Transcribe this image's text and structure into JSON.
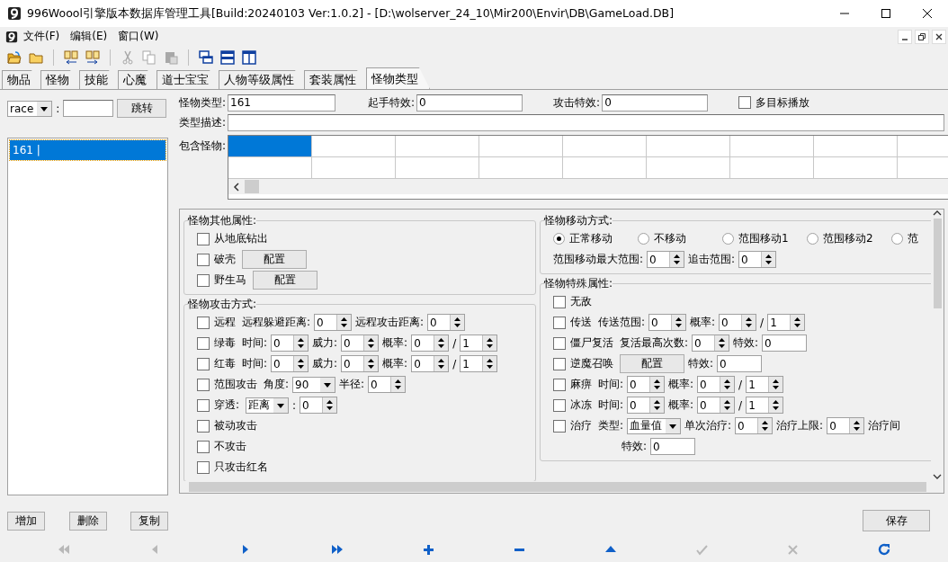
{
  "window": {
    "title": "996Woool引擎版本数据库管理工具[Build:20240103 Ver:1.0.2] - [D:\\wolserver_24_10\\Mir200\\Envir\\DB\\GameLoad.DB]"
  },
  "menu": [
    {
      "label": "文件(F)"
    },
    {
      "label": "编辑(E)"
    },
    {
      "label": "窗口(W)"
    }
  ],
  "toolbar": [
    [
      {
        "kind": "open-folder",
        "disabled": false
      },
      {
        "kind": "folder",
        "disabled": false
      }
    ],
    [
      {
        "kind": "copy-left",
        "disabled": false
      },
      {
        "kind": "copy-right",
        "disabled": false
      }
    ],
    [
      {
        "kind": "cut",
        "disabled": true
      },
      {
        "kind": "copy",
        "disabled": true
      },
      {
        "kind": "paste",
        "disabled": true
      }
    ],
    [
      {
        "kind": "cascade",
        "disabled": false
      },
      {
        "kind": "tile-horizontal",
        "disabled": false
      },
      {
        "kind": "tile-vertical",
        "disabled": false
      }
    ]
  ],
  "tabs": [
    {
      "label": "物品",
      "selected": false
    },
    {
      "label": "怪物",
      "selected": false
    },
    {
      "label": "技能",
      "selected": false
    },
    {
      "label": "心魔",
      "selected": false
    },
    {
      "label": "道士宝宝",
      "selected": false
    },
    {
      "label": "人物等级属性",
      "selected": false
    },
    {
      "label": "套装属性",
      "selected": false
    },
    {
      "label": "怪物类型",
      "selected": true
    }
  ],
  "search": {
    "field": "race",
    "separator": ":",
    "button": "跳转"
  },
  "records": [
    {
      "label": "161 |",
      "selected": true
    }
  ],
  "list_buttons": [
    "增加",
    "删除",
    "复制"
  ],
  "header": {
    "type_label": "怪物类型:",
    "type_value": "161",
    "start_label": "起手特效:",
    "start_value": "0",
    "attack_label": "攻击特效:",
    "attack_value": "0",
    "multi_target": {
      "label": "多目标播放",
      "checked": false
    },
    "desc_label": "类型描述:",
    "monsters_label": "包含怪物:"
  },
  "monster_grid": [
    [
      {
        "selected": true
      },
      {
        "selected": false
      },
      {
        "selected": false
      },
      {
        "selected": false
      },
      {
        "selected": false
      },
      {
        "selected": false
      },
      {
        "selected": false
      },
      {
        "selected": false
      },
      {
        "selected": false
      }
    ],
    [
      {
        "selected": false
      },
      {
        "selected": false
      },
      {
        "selected": false
      },
      {
        "selected": false
      },
      {
        "selected": false
      },
      {
        "selected": false
      },
      {
        "selected": false
      },
      {
        "selected": false
      },
      {
        "selected": false
      }
    ]
  ],
  "left_groups": [
    {
      "title": "怪物其他属性:",
      "rows": [
        {
          "items": [
            {
              "kind": "checkbox",
              "label": "从地底钻出",
              "checked": false
            }
          ]
        },
        {
          "items": [
            {
              "kind": "checkbox",
              "label": "破壳",
              "checked": false
            },
            {
              "kind": "button",
              "label": "配置"
            }
          ]
        },
        {
          "items": [
            {
              "kind": "checkbox",
              "label": "野生马",
              "checked": false
            },
            {
              "kind": "button",
              "label": "配置"
            }
          ]
        }
      ]
    },
    {
      "title": "怪物攻击方式:",
      "rows": [
        {
          "items": [
            {
              "kind": "checkbox",
              "label": "远程",
              "checked": false
            },
            {
              "kind": "label",
              "text": "远程躲避距离:"
            },
            {
              "kind": "spin",
              "value": "0"
            },
            {
              "kind": "label",
              "text": "远程攻击距离:"
            },
            {
              "kind": "spin",
              "value": "0"
            }
          ]
        },
        {
          "items": [
            {
              "kind": "checkbox",
              "label": "绿毒",
              "checked": false
            },
            {
              "kind": "label",
              "text": "时间:"
            },
            {
              "kind": "spin",
              "value": "0"
            },
            {
              "kind": "label",
              "text": "威力:"
            },
            {
              "kind": "spin",
              "value": "0"
            },
            {
              "kind": "label",
              "text": "概率:"
            },
            {
              "kind": "spin",
              "value": "0"
            },
            {
              "kind": "label",
              "text": "/"
            },
            {
              "kind": "spin",
              "value": "1"
            }
          ]
        },
        {
          "items": [
            {
              "kind": "checkbox",
              "label": "红毒",
              "checked": false
            },
            {
              "kind": "label",
              "text": "时间:"
            },
            {
              "kind": "spin",
              "value": "0"
            },
            {
              "kind": "label",
              "text": "威力:"
            },
            {
              "kind": "spin",
              "value": "0"
            },
            {
              "kind": "label",
              "text": "概率:"
            },
            {
              "kind": "spin",
              "value": "0"
            },
            {
              "kind": "label",
              "text": "/"
            },
            {
              "kind": "spin",
              "value": "1"
            }
          ]
        },
        {
          "items": [
            {
              "kind": "checkbox",
              "label": "范围攻击",
              "checked": false
            },
            {
              "kind": "label",
              "text": "角度:"
            },
            {
              "kind": "combo",
              "value": "90"
            },
            {
              "kind": "label",
              "text": "半径:"
            },
            {
              "kind": "spin",
              "value": "0"
            }
          ]
        },
        {
          "items": [
            {
              "kind": "checkbox",
              "label": "穿透:",
              "checked": false
            },
            {
              "kind": "combo",
              "value": "距离"
            },
            {
              "kind": "label",
              "text": ":"
            },
            {
              "kind": "spin",
              "value": "0"
            }
          ]
        },
        {
          "items": [
            {
              "kind": "checkbox",
              "label": "被动攻击",
              "checked": false
            }
          ]
        },
        {
          "items": [
            {
              "kind": "checkbox",
              "label": "不攻击",
              "checked": false
            }
          ]
        },
        {
          "items": [
            {
              "kind": "checkbox",
              "label": "只攻击红名",
              "checked": false
            }
          ]
        }
      ]
    }
  ],
  "right_groups": [
    {
      "title": "怪物移动方式:",
      "rows": [
        {
          "items": [
            {
              "kind": "radio",
              "label": "正常移动",
              "selected": true
            },
            {
              "kind": "radio",
              "label": "不移动",
              "selected": false
            },
            {
              "kind": "radio",
              "label": "范围移动1",
              "selected": false
            },
            {
              "kind": "radio",
              "label": "范围移动2",
              "selected": false
            },
            {
              "kind": "radio",
              "label": "范",
              "selected": false
            }
          ]
        },
        {
          "items": [
            {
              "kind": "label",
              "text": "范围移动最大范围:"
            },
            {
              "kind": "spin",
              "value": "0"
            },
            {
              "kind": "label",
              "text": "追击范围:"
            },
            {
              "kind": "spin",
              "value": "0"
            }
          ]
        }
      ]
    },
    {
      "title": "怪物特殊属性:",
      "rows": [
        {
          "items": [
            {
              "kind": "checkbox",
              "label": "无敌",
              "checked": false
            }
          ]
        },
        {
          "items": [
            {
              "kind": "checkbox",
              "label": "传送",
              "checked": false
            },
            {
              "kind": "label",
              "text": "传送范围:"
            },
            {
              "kind": "spin",
              "value": "0"
            },
            {
              "kind": "label",
              "text": "概率:"
            },
            {
              "kind": "spin",
              "value": "0"
            },
            {
              "kind": "label",
              "text": "/"
            },
            {
              "kind": "spin",
              "value": "1"
            }
          ]
        },
        {
          "items": [
            {
              "kind": "checkbox",
              "label": "僵尸复活",
              "checked": false
            },
            {
              "kind": "label",
              "text": "复活最高次数:"
            },
            {
              "kind": "spin",
              "value": "0"
            },
            {
              "kind": "label",
              "text": "特效:"
            },
            {
              "kind": "text",
              "value": "0"
            }
          ]
        },
        {
          "items": [
            {
              "kind": "checkbox",
              "label": "逆魔召唤",
              "checked": false
            },
            {
              "kind": "button",
              "label": "配置"
            },
            {
              "kind": "label",
              "text": "特效:"
            },
            {
              "kind": "text",
              "value": "0"
            }
          ]
        },
        {
          "items": [
            {
              "kind": "checkbox",
              "label": "麻痹",
              "checked": false
            },
            {
              "kind": "label",
              "text": "时间:"
            },
            {
              "kind": "spin",
              "value": "0"
            },
            {
              "kind": "label",
              "text": "概率:"
            },
            {
              "kind": "spin",
              "value": "0"
            },
            {
              "kind": "label",
              "text": "/"
            },
            {
              "kind": "spin",
              "value": "1"
            }
          ]
        },
        {
          "items": [
            {
              "kind": "checkbox",
              "label": "冰冻",
              "checked": false
            },
            {
              "kind": "label",
              "text": "时间:"
            },
            {
              "kind": "spin",
              "value": "0"
            },
            {
              "kind": "label",
              "text": "概率:"
            },
            {
              "kind": "spin",
              "value": "0"
            },
            {
              "kind": "label",
              "text": "/"
            },
            {
              "kind": "spin",
              "value": "1"
            }
          ]
        },
        {
          "items": [
            {
              "kind": "checkbox",
              "label": "治疗",
              "checked": false
            },
            {
              "kind": "label",
              "text": "类型:"
            },
            {
              "kind": "combo",
              "value": "血量值"
            },
            {
              "kind": "label",
              "text": "单次治疗:"
            },
            {
              "kind": "spin",
              "value": "0"
            },
            {
              "kind": "label",
              "text": "治疗上限:"
            },
            {
              "kind": "spin",
              "value": "0"
            },
            {
              "kind": "label",
              "text": "治疗间"
            }
          ]
        },
        {
          "items": [
            {
              "kind": "label",
              "text": "特效:"
            },
            {
              "kind": "text",
              "value": "0"
            }
          ]
        }
      ]
    }
  ],
  "save_button": "保存",
  "nav": [
    {
      "kind": "first",
      "disabled": true
    },
    {
      "kind": "prior",
      "disabled": true
    },
    {
      "kind": "next",
      "disabled": false
    },
    {
      "kind": "last",
      "disabled": false
    },
    {
      "kind": "insert",
      "disabled": false
    },
    {
      "kind": "delete",
      "disabled": false
    },
    {
      "kind": "edit",
      "disabled": false
    },
    {
      "kind": "post",
      "disabled": true
    },
    {
      "kind": "cancel",
      "disabled": true
    },
    {
      "kind": "refresh",
      "disabled": false
    }
  ]
}
